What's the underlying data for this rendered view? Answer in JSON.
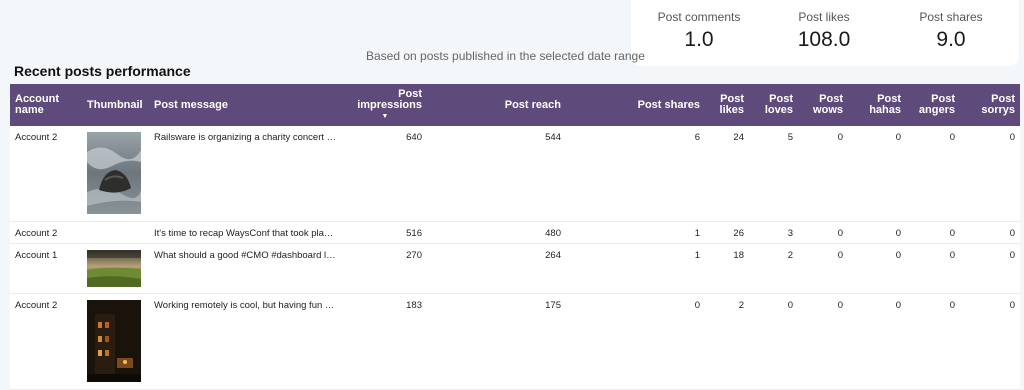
{
  "kpis": [
    {
      "label": "Post comments",
      "value": "1.0"
    },
    {
      "label": "Post likes",
      "value": "108.0"
    },
    {
      "label": "Post shares",
      "value": "9.0"
    }
  ],
  "note": "Based on posts published in the selected date range",
  "section_title": "Recent posts performance",
  "table": {
    "headers": {
      "account": "Account name",
      "thumbnail": "Thumbnail",
      "message": "Post message",
      "impressions": "Post impressions",
      "reach": "Post reach",
      "shares": "Post shares",
      "likes": "Post likes",
      "loves": "Post loves",
      "wows": "Post wows",
      "hahas": "Post hahas",
      "angers": "Post angers",
      "sorrys": "Post sorrys"
    },
    "sort_icon": "▼",
    "rows": [
      {
        "account": "Account 2",
        "message": "Railsware is organizing a charity concert in ...",
        "impressions": "640",
        "reach": "544",
        "shares": "6",
        "likes": "24",
        "loves": "5",
        "wows": "0",
        "hahas": "0",
        "angers": "0",
        "sorrys": "0",
        "thumbnail": "rock-sea-photo"
      },
      {
        "account": "Account 2",
        "message": "It's time to recap WaysConf that took place ...",
        "impressions": "516",
        "reach": "480",
        "shares": "1",
        "likes": "26",
        "loves": "3",
        "wows": "0",
        "hahas": "0",
        "angers": "0",
        "sorrys": "0",
        "thumbnail": ""
      },
      {
        "account": "Account 1",
        "message": "What should a good #CMO #dashboard loo...",
        "impressions": "270",
        "reach": "264",
        "shares": "1",
        "likes": "18",
        "loves": "2",
        "wows": "0",
        "hahas": "0",
        "angers": "0",
        "sorrys": "0",
        "thumbnail": "field-landscape-photo"
      },
      {
        "account": "Account 2",
        "message": "Working remotely is cool, but having fun wit...",
        "impressions": "183",
        "reach": "175",
        "shares": "0",
        "likes": "2",
        "loves": "0",
        "wows": "0",
        "hahas": "0",
        "angers": "0",
        "sorrys": "0",
        "thumbnail": "night-street-photo"
      }
    ]
  }
}
